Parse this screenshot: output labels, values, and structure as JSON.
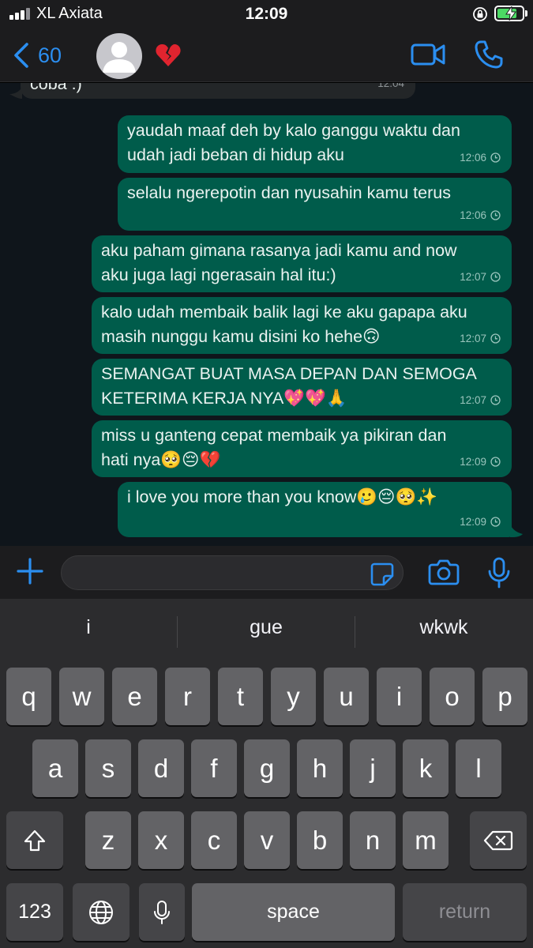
{
  "status_bar": {
    "carrier": "XL Axiata",
    "time": "12:09"
  },
  "nav": {
    "back_count": "60",
    "contact_emoji": "broken-heart",
    "accent_color": "#2b8ef0"
  },
  "messages": [
    {
      "direction": "incoming",
      "text": "coba :)",
      "time": "12:04"
    },
    {
      "direction": "outgoing",
      "text": "yaudah maaf deh by kalo ganggu waktu dan\nudah jadi beban di hidup aku",
      "time": "12:06"
    },
    {
      "direction": "outgoing",
      "text": "selalu ngerepotin dan nyusahin kamu terus",
      "time": "12:06"
    },
    {
      "direction": "outgoing",
      "text": "aku paham gimana rasanya jadi kamu and now\naku juga lagi ngerasain hal itu:)",
      "time": "12:07"
    },
    {
      "direction": "outgoing",
      "text": "kalo udah membaik balik lagi ke aku gapapa aku\nmasih nunggu kamu disini ko hehe🙃",
      "time": "12:07"
    },
    {
      "direction": "outgoing",
      "text": "SEMANGAT BUAT MASA DEPAN DAN SEMOGA\nKETERIMA KERJA NYA💖💖🙏",
      "time": "12:07"
    },
    {
      "direction": "outgoing",
      "text": "miss u ganteng cepat membaik ya pikiran dan\nhati nya🥺😔💔",
      "time": "12:09"
    },
    {
      "direction": "outgoing",
      "text": "i love you more than you know🥲😔🥺✨",
      "time": "12:09"
    }
  ],
  "input": {
    "value": ""
  },
  "keyboard": {
    "suggestions": [
      "i",
      "gue",
      "wkwk"
    ],
    "row1": [
      "q",
      "w",
      "e",
      "r",
      "t",
      "y",
      "u",
      "i",
      "o",
      "p"
    ],
    "row2": [
      "a",
      "s",
      "d",
      "f",
      "g",
      "h",
      "j",
      "k",
      "l"
    ],
    "row3": [
      "z",
      "x",
      "c",
      "v",
      "b",
      "n",
      "m"
    ],
    "numbers_label": "123",
    "space_label": "space",
    "return_label": "return"
  },
  "icons": {
    "back": "chevron-left-icon",
    "video": "video-camera-icon",
    "call": "phone-icon",
    "plus": "plus-icon",
    "sticker": "sticker-icon",
    "camera": "camera-icon",
    "mic": "microphone-icon",
    "shift": "shift-icon",
    "delete": "backspace-icon",
    "globe": "globe-icon",
    "dictation": "microphone-icon"
  },
  "colors": {
    "outgoing_bubble": "#005c4b",
    "incoming_bubble": "#232628",
    "chat_background": "#0f151b"
  }
}
